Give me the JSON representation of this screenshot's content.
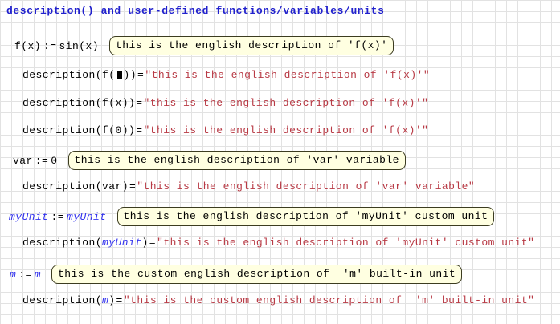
{
  "colors": {
    "background": "#ffffff",
    "grid_line": "#e2e2e2",
    "title": "#2121cd",
    "math": "#000000",
    "string_result": "#b83a45",
    "unit": "#3535ee",
    "note_bg": "#ffffe1",
    "note_border": "#3c3c20"
  },
  "title": "description() and user-defined functions/variables/units",
  "assign_symbol": ":=",
  "equals_symbol": "=",
  "rows": {
    "f_def": {
      "lhs": "f(x)",
      "rhs": "sin(x)",
      "note": "this is the english description of 'f(x)'"
    },
    "desc_f_placeholder": {
      "pre": "description(f(",
      "post": "))",
      "result": "\"this is the english description of 'f(x)'\""
    },
    "desc_f_x": {
      "call": "description(f(x))",
      "result": "\"this is the english description of 'f(x)'\""
    },
    "desc_f_0": {
      "call": "description(f(0))",
      "result": "\"this is the english description of 'f(x)'\""
    },
    "var_def": {
      "lhs": "var",
      "rhs": "0",
      "note": "this is the english description of 'var' variable"
    },
    "desc_var": {
      "call": "description(var)",
      "result": "\"this is the english description of 'var' variable\""
    },
    "myunit_def": {
      "lhs": "myUnit",
      "rhs": "myUnit",
      "note": "this is the english description of 'myUnit' custom unit"
    },
    "desc_myunit": {
      "pre": "description(",
      "unit": "myUnit",
      "post": ")",
      "result": "\"this is the english description of 'myUnit' custom unit\""
    },
    "m_def": {
      "lhs": "m",
      "rhs": "m",
      "note": "this is the custom english description of  'm' built-in unit"
    },
    "desc_m": {
      "pre": "description(",
      "unit": "m",
      "post": ")",
      "result": "\"this is the custom english description of  'm' built-in unit\""
    }
  }
}
